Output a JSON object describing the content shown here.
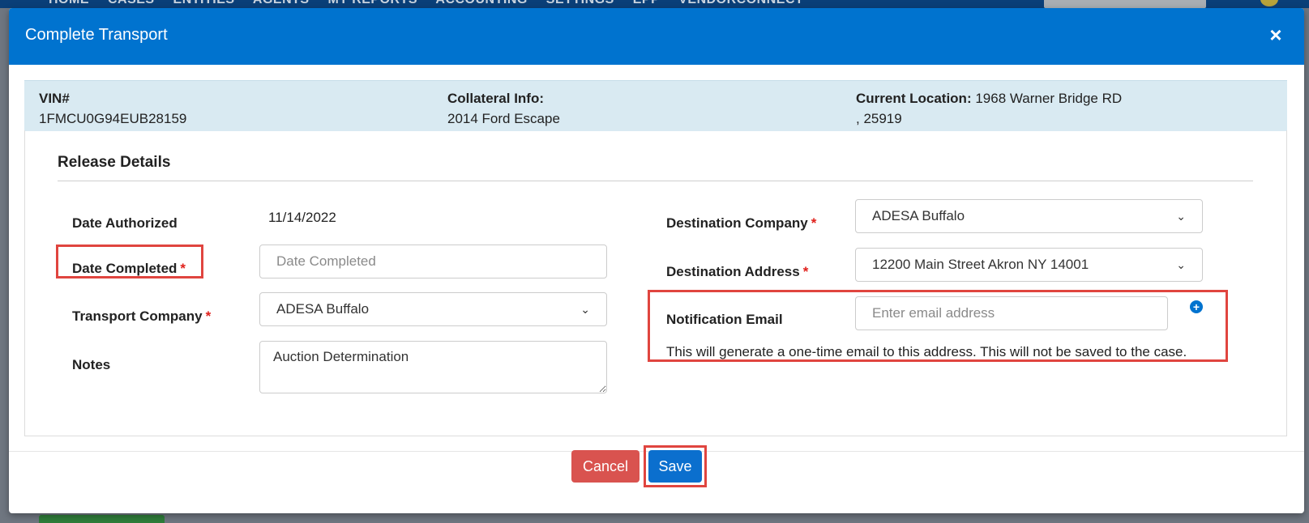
{
  "background_nav": {
    "items": [
      "HOME",
      "CASES",
      "ENTITIES",
      "AGENTS",
      "MY REPORTS",
      "ACCOUNTING",
      "SETTINGS",
      "EPP",
      "VENDORCONNECT"
    ]
  },
  "modal": {
    "title": "Complete Transport",
    "close_icon": "×"
  },
  "vehicle_info": {
    "vin_label": "VIN#",
    "vin_value": "1FMCU0G94EUB28159",
    "collateral_label": "Collateral Info:",
    "collateral_value": "2014 Ford Escape",
    "location_label": "Current Location:",
    "location_line1": "1968 Warner Bridge RD",
    "location_line2": ", 25919"
  },
  "release": {
    "section_title": "Release Details",
    "date_authorized_label": "Date Authorized",
    "date_authorized_value": "11/14/2022",
    "date_completed_label": "Date Completed",
    "date_completed_placeholder": "Date Completed",
    "date_completed_value": "",
    "transport_company_label": "Transport Company",
    "transport_company_value": "ADESA Buffalo",
    "notes_label": "Notes",
    "notes_value": "Auction Determination",
    "destination_company_label": "Destination Company",
    "destination_company_value": "ADESA Buffalo",
    "destination_address_label": "Destination Address",
    "destination_address_value": "12200 Main Street Akron NY 14001",
    "notification_email_label": "Notification Email",
    "notification_email_placeholder": "Enter email address",
    "notification_help": "This will generate a one-time email to this address. This will not be saved to the case.",
    "required_mark": "*"
  },
  "footer": {
    "cancel_label": "Cancel",
    "save_label": "Save"
  },
  "colors": {
    "header": "#0073cf",
    "info_bar": "#d9eaf2",
    "cancel": "#d9534f",
    "save": "#0b6fce",
    "highlight": "#e0453f",
    "required": "#e0201b"
  }
}
